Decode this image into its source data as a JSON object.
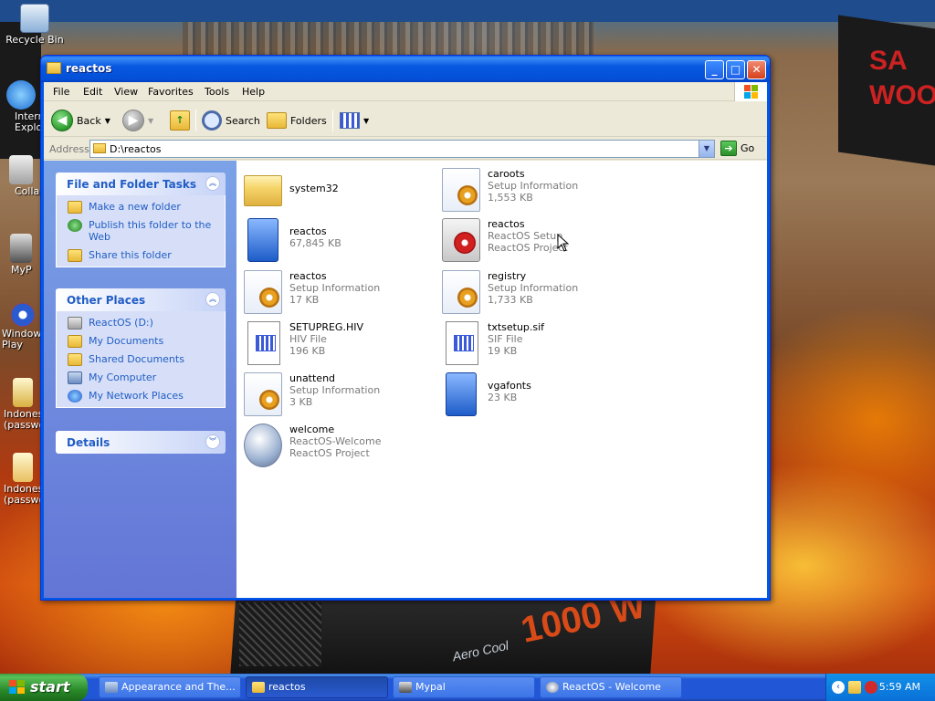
{
  "desktop": {
    "icons": [
      {
        "label": "Recycle Bin"
      },
      {
        "label": "Intern Explo"
      },
      {
        "label": "Collab"
      },
      {
        "label": "MyP"
      },
      {
        "label": "Windows Play"
      },
      {
        "label": "Indones (passwo"
      },
      {
        "label": "Indones (passwo"
      }
    ],
    "wallpaper": {
      "sign_text": "SAI WOO",
      "psu_text": "1000 W",
      "psu_brand": "Aero Cool"
    }
  },
  "window": {
    "title": "reactos",
    "controls": {
      "minimize": "_",
      "maximize": "□",
      "close": "✕"
    },
    "menu": [
      "File",
      "Edit",
      "View",
      "Favorites",
      "Tools",
      "Help"
    ],
    "toolbar": {
      "back": "Back",
      "search": "Search",
      "folders": "Folders"
    },
    "address": {
      "label": "Address",
      "value": "D:\\reactos",
      "go": "Go"
    },
    "task_pane": {
      "file_tasks": {
        "title": "File and Folder Tasks",
        "links": [
          "Make a new folder",
          "Publish this folder to the Web",
          "Share this folder"
        ]
      },
      "other_places": {
        "title": "Other Places",
        "links": [
          "ReactOS (D:)",
          "My Documents",
          "Shared Documents",
          "My Computer",
          "My Network Places"
        ]
      },
      "details": {
        "title": "Details"
      }
    },
    "files": [
      {
        "name": "system32",
        "line2": "",
        "line3": "",
        "icon": "folder-icon"
      },
      {
        "name": "caroots",
        "line2": "Setup Information",
        "line3": "1,553 KB",
        "icon": "setup-info-icon"
      },
      {
        "name": "reactos",
        "line2": "67,845 KB",
        "line3": "",
        "icon": "application-icon"
      },
      {
        "name": "reactos",
        "line2": "ReactOS Setup",
        "line3": "ReactOS Project",
        "icon": "setup-cd-icon"
      },
      {
        "name": "reactos",
        "line2": "Setup Information",
        "line3": "17 KB",
        "icon": "setup-info-icon"
      },
      {
        "name": "registry",
        "line2": "Setup Information",
        "line3": "1,733 KB",
        "icon": "setup-info-icon"
      },
      {
        "name": "SETUPREG.HIV",
        "line2": "HIV File",
        "line3": "196 KB",
        "icon": "hiv-file-icon"
      },
      {
        "name": "txtsetup.sif",
        "line2": "SIF File",
        "line3": "19 KB",
        "icon": "sif-file-icon"
      },
      {
        "name": "unattend",
        "line2": "Setup Information",
        "line3": "3 KB",
        "icon": "setup-info-icon"
      },
      {
        "name": "vgafonts",
        "line2": "23 KB",
        "line3": "",
        "icon": "application-icon"
      },
      {
        "name": "welcome",
        "line2": "ReactOS-Welcome",
        "line3": "ReactOS Project",
        "icon": "welcome-app-icon"
      }
    ]
  },
  "taskbar": {
    "start": "start",
    "tasks": [
      {
        "label": "Appearance and The..."
      },
      {
        "label": "reactos"
      },
      {
        "label": "Mypal"
      },
      {
        "label": "ReactOS - Welcome"
      }
    ],
    "clock": "5:59 AM"
  }
}
